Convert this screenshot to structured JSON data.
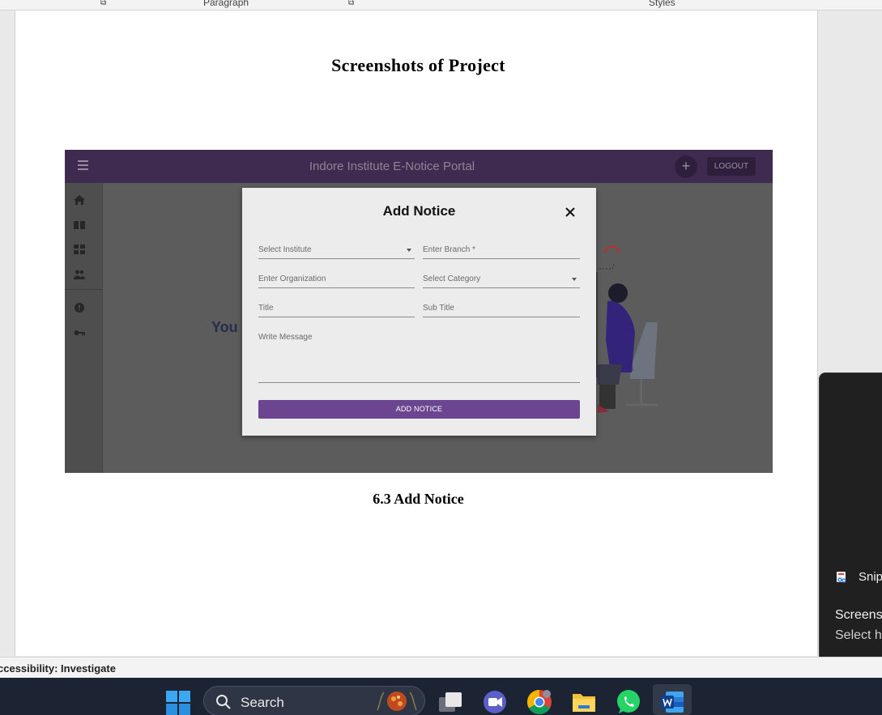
{
  "ribbon": {
    "paragraph_label": "Paragraph",
    "styles_label": "Styles",
    "launcher_glyph": "⧉"
  },
  "document": {
    "heading": "Screenshots of Project",
    "caption": "6.3 Add Notice"
  },
  "embedded_app": {
    "title": "Indore Institute E-Notice Portal",
    "plus_label": "+",
    "logout_label": "LOGOUT",
    "background_text": "You",
    "sidebar_icons": [
      "home-icon",
      "book-icon",
      "dashboard-icon",
      "people-icon",
      "info-icon",
      "key-icon"
    ],
    "modal": {
      "title": "Add Notice",
      "fields": {
        "institute": "Select Institute",
        "branch": "Enter Branch *",
        "organization": "Enter Organization",
        "category": "Select Category",
        "title": "Title",
        "subtitle": "Sub Title",
        "message": "Write Message"
      },
      "submit_label": "ADD NOTICE"
    },
    "accent_color": "#6c4590"
  },
  "toast": {
    "app_name": "Snip",
    "line1": "Screens",
    "line2": "Select h"
  },
  "status_bar": {
    "accessibility": "ccessibility: Investigate"
  },
  "taskbar": {
    "search_label": "Search",
    "apps": [
      "task-view-icon",
      "chat-icon",
      "chrome-icon",
      "file-explorer-icon",
      "whatsapp-icon",
      "word-icon"
    ]
  }
}
